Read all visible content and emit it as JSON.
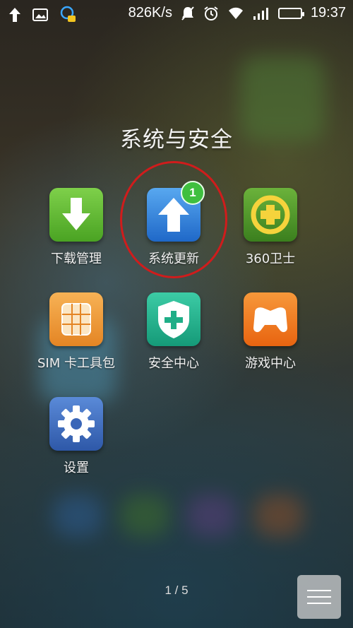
{
  "status_bar": {
    "speed": "826K/s",
    "time": "19:37",
    "icons": [
      "upload-arrow-icon",
      "image-icon",
      "assistant-icon",
      "mute-icon",
      "alarm-icon",
      "wifi-icon",
      "signal-icon",
      "battery-icon"
    ],
    "battery_level": 1.0
  },
  "folder": {
    "title": "系统与安全",
    "apps": [
      {
        "label": "下载管理",
        "icon": "download-arrow-icon",
        "color": "#5ab52e"
      },
      {
        "label": "系统更新",
        "icon": "update-arrow-icon",
        "color": "#2d7fd6",
        "badge": "1"
      },
      {
        "label": "360卫士",
        "icon": "360-shield-icon",
        "color": "#4f9a2c"
      },
      {
        "label": "SIM 卡工具包",
        "icon": "sim-card-icon",
        "color": "#f09a3a"
      },
      {
        "label": "安全中心",
        "icon": "security-shield-icon",
        "color": "#22b58f"
      },
      {
        "label": "游戏中心",
        "icon": "gamepad-icon",
        "color": "#f07a1a"
      },
      {
        "label": "设置",
        "icon": "settings-gear-icon",
        "color": "#3f6fc0"
      }
    ]
  },
  "pager": {
    "text": "1 / 5"
  },
  "highlight_color": "#d01c1c"
}
